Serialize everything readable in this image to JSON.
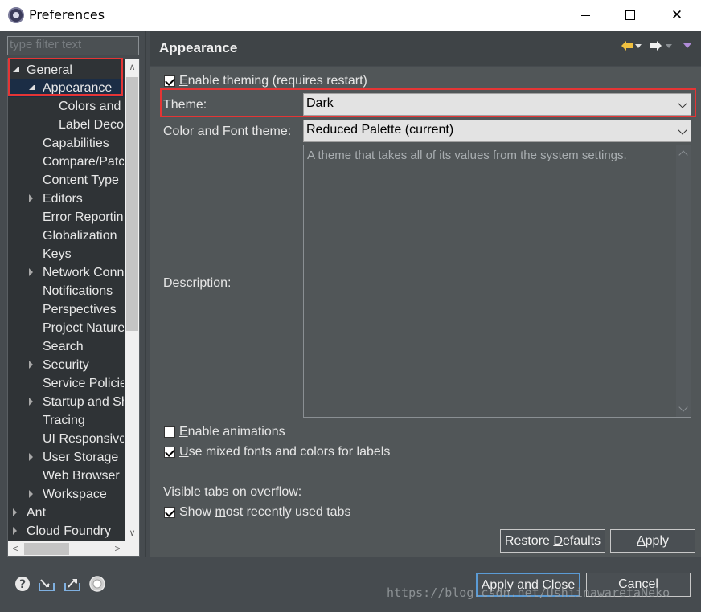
{
  "window": {
    "title": "Preferences"
  },
  "filter": {
    "placeholder": "type filter text"
  },
  "tree": {
    "items": [
      {
        "label": "General"
      },
      {
        "label": "Appearance"
      },
      {
        "label": "Colors and"
      },
      {
        "label": "Label Deco"
      },
      {
        "label": "Capabilities"
      },
      {
        "label": "Compare/Patc"
      },
      {
        "label": "Content Type"
      },
      {
        "label": "Editors"
      },
      {
        "label": "Error Reportin"
      },
      {
        "label": "Globalization"
      },
      {
        "label": "Keys"
      },
      {
        "label": "Network Conn"
      },
      {
        "label": "Notifications"
      },
      {
        "label": "Perspectives"
      },
      {
        "label": "Project Nature"
      },
      {
        "label": "Search"
      },
      {
        "label": "Security"
      },
      {
        "label": "Service Policie"
      },
      {
        "label": "Startup and Sh"
      },
      {
        "label": "Tracing"
      },
      {
        "label": "UI Responsive"
      },
      {
        "label": "User Storage"
      },
      {
        "label": "Web Browser"
      },
      {
        "label": "Workspace"
      },
      {
        "label": "Ant"
      },
      {
        "label": "Cloud Foundry"
      }
    ]
  },
  "page": {
    "title": "Appearance",
    "enable_theming": {
      "prefix": "",
      "mnemonic": "E",
      "rest": "nable theming (requires restart)",
      "checked": true
    },
    "theme": {
      "label": "Theme:",
      "value": "Dark"
    },
    "color_font_theme": {
      "label": "Color and Font theme:",
      "value": "Reduced Palette (current)"
    },
    "description": {
      "label": "Description:",
      "text": "A theme that takes all of its values from the system settings."
    },
    "enable_animations": {
      "mnemonic": "E",
      "rest": "nable animations",
      "checked": false
    },
    "mixed_fonts": {
      "mnemonic": "U",
      "rest": "se mixed fonts and colors for labels",
      "checked": true
    },
    "visible_tabs_label": "Visible tabs on overflow:",
    "show_mru": {
      "prefix": "Show ",
      "mnemonic": "m",
      "rest": "ost recently used tabs",
      "checked": true
    },
    "restore_defaults": {
      "prefix": "Restore ",
      "mnemonic": "D",
      "rest": "efaults"
    },
    "apply": {
      "mnemonic": "A",
      "rest": "pply"
    }
  },
  "footer": {
    "apply_and_close": "Apply and Close",
    "cancel": "Cancel",
    "watermark": "https://blog.csdn.net/UshiinawaretaNeko"
  },
  "colors": {
    "dialog_bg": "#464b4f",
    "tree_bg": "#2f3336",
    "selection": "#1b2d45",
    "highlight": "#e53535",
    "primary_border": "#5b9bd5"
  }
}
